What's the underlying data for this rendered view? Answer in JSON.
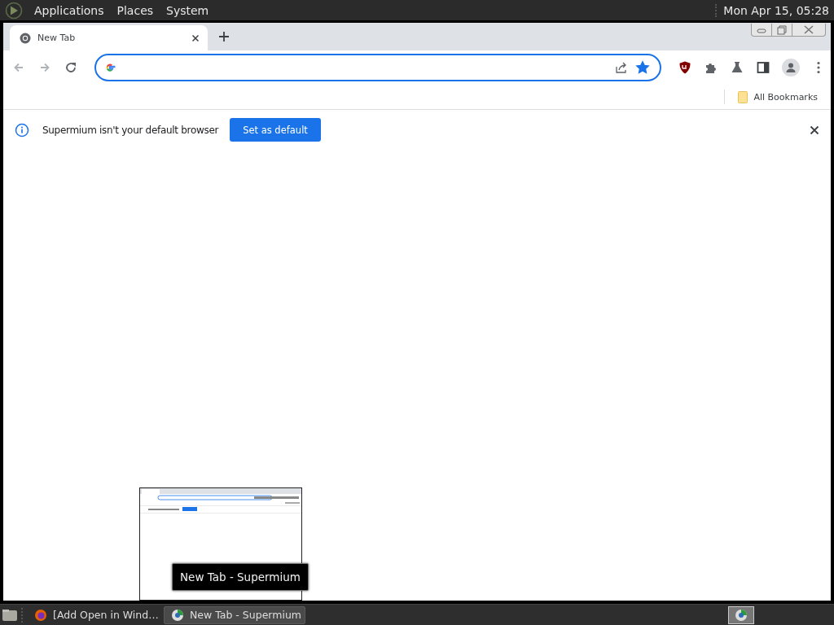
{
  "top_panel": {
    "menus": [
      "Applications",
      "Places",
      "System"
    ],
    "clock": "Mon Apr 15, 05:28"
  },
  "browser": {
    "tabs": [
      {
        "title": "New Tab",
        "selected": true
      }
    ],
    "bookmarked": true,
    "bookmarks": [
      "All Bookmarks"
    ],
    "infobar": {
      "message": "Supermium isn't your default browser",
      "button": "Set as default"
    }
  },
  "preview": {
    "tooltip": "New Tab - Supermium"
  },
  "taskbar": {
    "tasks": [
      {
        "label": "[Add Open in Wind…",
        "selected": false,
        "kind": "firefox"
      },
      {
        "label": "New Tab - Supermium",
        "selected": true,
        "kind": "browser"
      }
    ]
  }
}
